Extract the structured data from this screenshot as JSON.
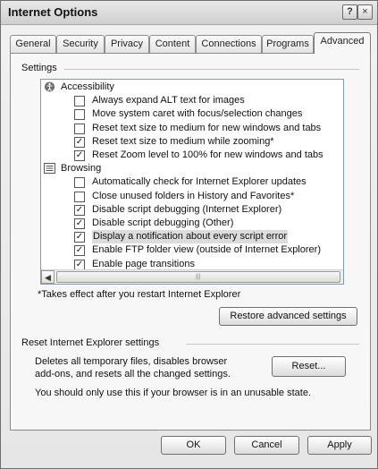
{
  "window": {
    "title": "Internet Options",
    "help_glyph": "?",
    "close_glyph": "×"
  },
  "tabs": [
    {
      "label": "General"
    },
    {
      "label": "Security"
    },
    {
      "label": "Privacy"
    },
    {
      "label": "Content"
    },
    {
      "label": "Connections"
    },
    {
      "label": "Programs"
    },
    {
      "label": "Advanced",
      "active": true
    }
  ],
  "settings": {
    "group_label": "Settings",
    "items": [
      {
        "type": "category",
        "icon": "accessibility-icon",
        "label": "Accessibility"
      },
      {
        "type": "checkbox",
        "label": "Always expand ALT text for images",
        "checked": false
      },
      {
        "type": "checkbox",
        "label": "Move system caret with focus/selection changes",
        "checked": false
      },
      {
        "type": "checkbox",
        "label": "Reset text size to medium for new windows and tabs",
        "checked": false
      },
      {
        "type": "checkbox",
        "label": "Reset text size to medium while zooming*",
        "checked": true
      },
      {
        "type": "checkbox",
        "label": "Reset Zoom level to 100% for new windows and tabs",
        "checked": true
      },
      {
        "type": "category",
        "icon": "browsing-icon",
        "label": "Browsing"
      },
      {
        "type": "checkbox",
        "label": "Automatically check for Internet Explorer updates",
        "checked": false
      },
      {
        "type": "checkbox",
        "label": "Close unused folders in History and Favorites*",
        "checked": false
      },
      {
        "type": "checkbox",
        "label": "Disable script debugging (Internet Explorer)",
        "checked": true
      },
      {
        "type": "checkbox",
        "label": "Disable script debugging (Other)",
        "checked": true
      },
      {
        "type": "checkbox",
        "label": "Display a notification about every script error",
        "checked": true,
        "highlighted": true
      },
      {
        "type": "checkbox",
        "label": "Enable FTP folder view (outside of Internet Explorer)",
        "checked": true
      },
      {
        "type": "checkbox",
        "label": "Enable page transitions",
        "checked": true
      }
    ],
    "note": "*Takes effect after you restart Internet Explorer",
    "restore_button": "Restore advanced settings"
  },
  "reset_section": {
    "group_label": "Reset Internet Explorer settings",
    "description_line1": "Deletes all temporary files, disables browser",
    "description_line2": "add-ons, and resets all the changed settings.",
    "reset_button": "Reset...",
    "warning": "You should only use this if your browser is in an unusable state."
  },
  "footer": {
    "ok": "OK",
    "cancel": "Cancel",
    "apply": "Apply"
  },
  "scroll": {
    "up": "▲",
    "down": "▼",
    "left": "◀",
    "right": "▶",
    "grip": "|||"
  },
  "check_mark": "✓"
}
